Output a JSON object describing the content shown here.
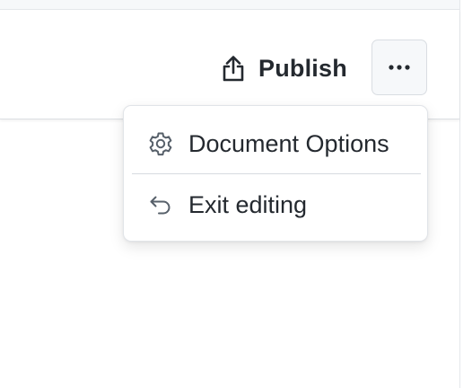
{
  "header": {
    "publish_label": "Publish",
    "publish_icon": "upload-icon",
    "more_icon": "ellipsis-icon"
  },
  "menu": {
    "items": [
      {
        "label": "Document Options",
        "icon": "gear-icon"
      },
      {
        "label": "Exit editing",
        "icon": "undo-arrow-icon"
      }
    ]
  },
  "colors": {
    "text": "#24292f",
    "icon": "#57606a",
    "border": "#d9dde2",
    "button_bg": "#f6f8fa",
    "menu_bg": "#ffffff"
  }
}
